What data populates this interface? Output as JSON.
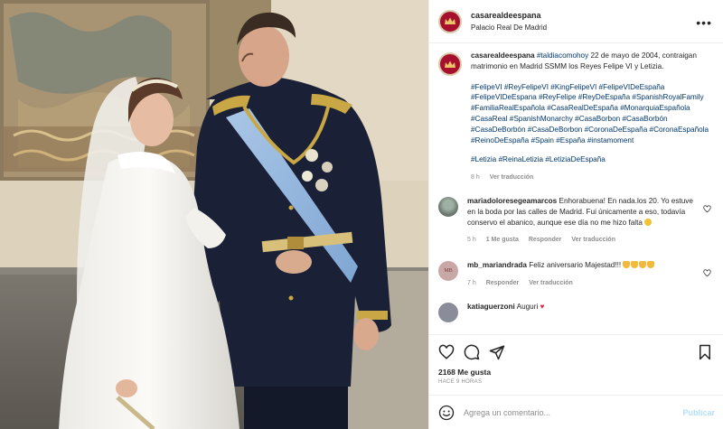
{
  "post": {
    "username": "casarealdeespana",
    "location": "Palacio Real De Madrid",
    "more_glyph": "•••"
  },
  "caption": {
    "username": "casarealdeespana",
    "tag_lead": "#taldiacomohoy",
    "text": " 22 de mayo de 2004, contraigan matrimonio en Madrid SSMM los Reyes Felipe VI y Letizia.",
    "hashtags": "#FelipeVI #ReyFelipeVI #KingFelipeVI #FelipeVIDeEspaña #FelipeVIDeEspana #ReyFelipe #ReyDeEspaña #SpanishRoyalFamily #FamiliaRealEspañola #CasaRealDeEspaña #MonarquiaEspañola #CasaReal #SpanishMonarchy #CasaBorbon #CasaBorbón #CasaDeBorbón #CasaDeBorbon #CoronaDeEspaña #CoronaEspañola #ReinoDeEspaña #Spain #España #instamoment",
    "hashtags2": "#Letizia #ReinaLetizia #LetiziaDeEspaña",
    "time": "8 h",
    "translate": "Ver traducción"
  },
  "comments": [
    {
      "username": "mariadoloresegeamarcos",
      "text": " Enhorabuena! En nada.los 20. Yo estuve en la boda por las calles de Madrid. Fui únicamente a eso, todavía conservo el abanico, aunque ese día no me hizo falta ",
      "time": "5 h",
      "likes": "1 Me gusta",
      "reply": "Responder",
      "translate": "Ver traducción"
    },
    {
      "username": "mb_mariandrada",
      "avatar_text": "MB",
      "text": " Feliz aniversario Majestad!!! ",
      "time": "7 h",
      "reply": "Responder",
      "translate": "Ver traducción"
    },
    {
      "username": "katiaguerzoni",
      "text": " Auguri "
    }
  ],
  "actions": {
    "likes": "2168 Me gusta",
    "date": "HACE 9 HORAS"
  },
  "add_comment": {
    "placeholder": "Agrega un comentario...",
    "publish": "Publicar"
  },
  "colors": {
    "hashtag": "#00376b",
    "avatar": "#a60f2d",
    "publish": "#b2dffc",
    "muted": "#8e8e8e"
  }
}
